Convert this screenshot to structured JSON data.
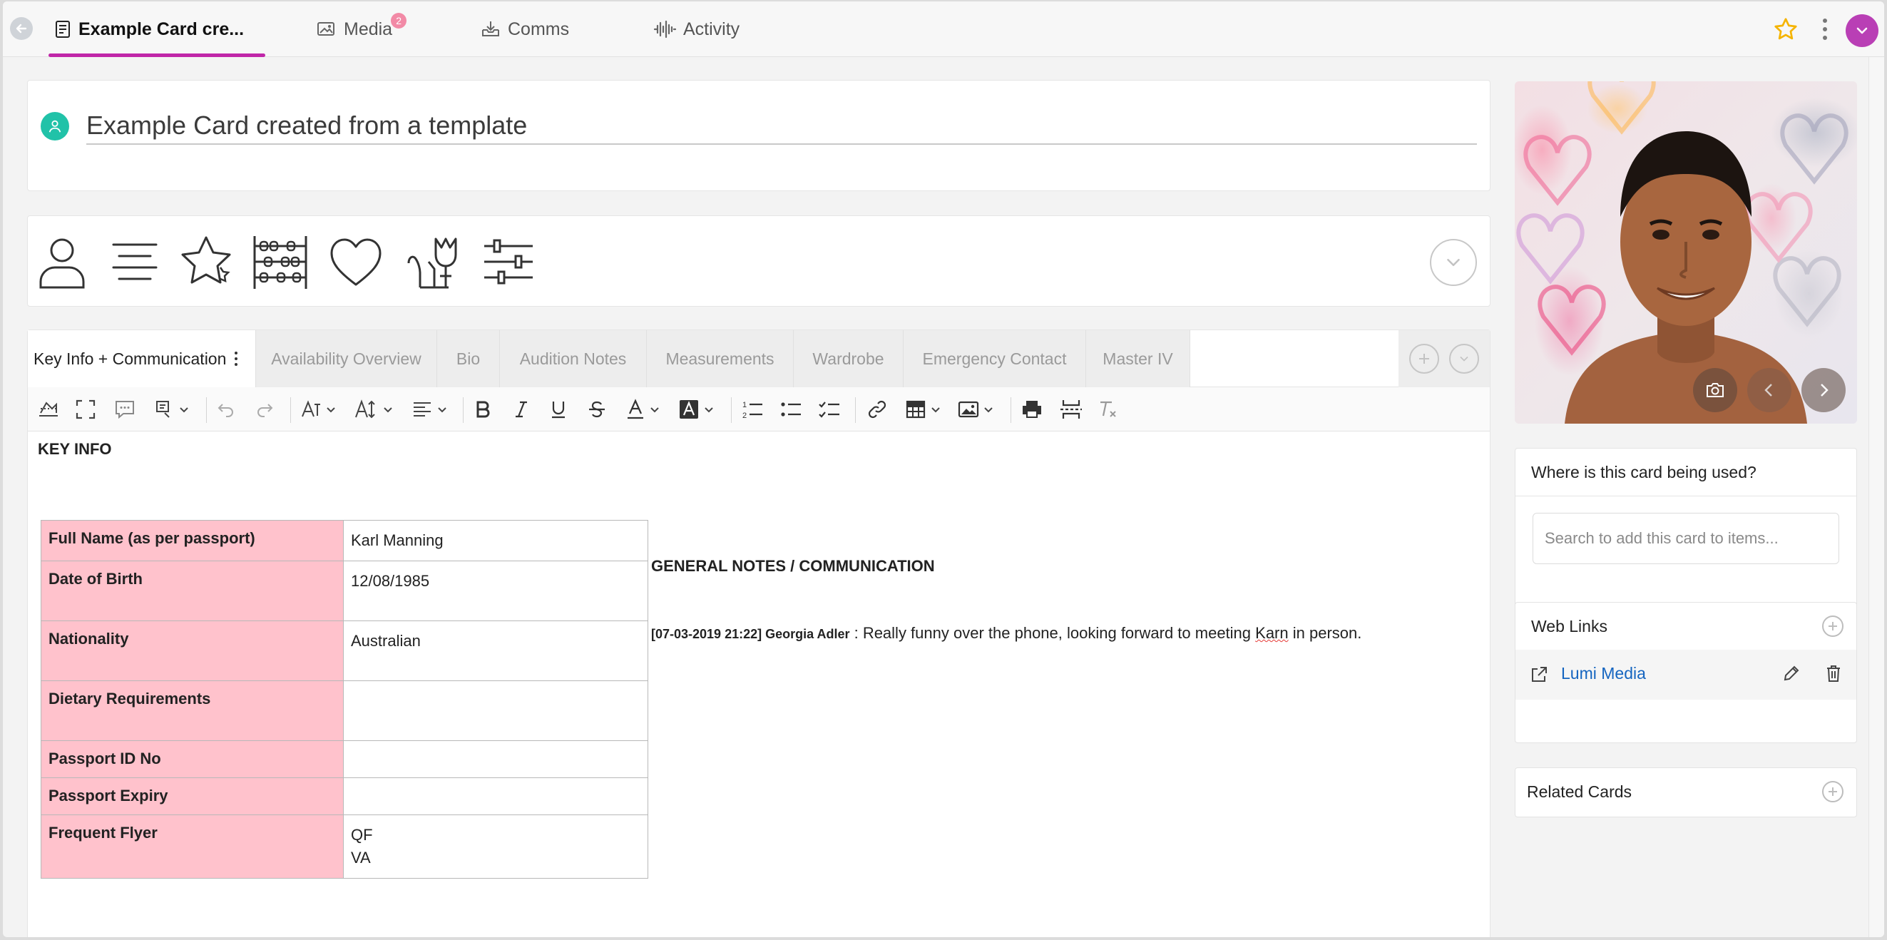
{
  "nav": {
    "tabs": [
      {
        "label": "Example Card cre...",
        "icon": "document-icon"
      },
      {
        "label": "Media",
        "icon": "image-icon",
        "badge": "2"
      },
      {
        "label": "Comms",
        "icon": "inbox-download-icon"
      },
      {
        "label": "Activity",
        "icon": "waveform-icon"
      }
    ]
  },
  "card": {
    "title": "Example Card created from a template"
  },
  "template_icons": [
    "person-icon",
    "text-lines-icon",
    "star-icon",
    "abacus-icon",
    "heart-icon",
    "cat-icon",
    "sliders-icon"
  ],
  "editor": {
    "tabs": [
      "Key Info + Communication",
      "Availability Overview",
      "Bio",
      "Audition Notes",
      "Measurements",
      "Wardrobe",
      "Emergency Contact",
      "Master IV"
    ],
    "toolbar": [
      "save-draft-icon",
      "fullscreen-icon",
      "comment-icon",
      "format-painter-icon",
      "undo-icon",
      "redo-icon",
      "font-family-icon",
      "font-size-icon",
      "align-icon",
      "bold-icon",
      "italic-icon",
      "underline-icon",
      "strikethrough-icon",
      "font-color-icon",
      "highlight-color-icon",
      "numbered-list-icon",
      "bullet-list-icon",
      "checklist-icon",
      "link-icon",
      "table-icon",
      "image-icon",
      "print-icon",
      "page-break-icon",
      "clear-format-icon"
    ]
  },
  "doc": {
    "key_info_heading": "KEY INFO",
    "rows": [
      {
        "label": "Full Name (as per passport)",
        "value": "Karl Manning"
      },
      {
        "label": "Date of Birth",
        "value": "12/08/1985"
      },
      {
        "label": "Nationality",
        "value": "Australian"
      },
      {
        "label": "Dietary Requirements",
        "value": ""
      },
      {
        "label": "Passport ID No",
        "value": ""
      },
      {
        "label": "Passport Expiry",
        "value": ""
      },
      {
        "label": "Frequent Flyer",
        "value": "QF",
        "value2": "VA"
      }
    ],
    "general_heading": "GENERAL NOTES / COMMUNICATION",
    "note": {
      "meta": "[07-03-2019 21:22] Georgia Adler",
      "sep": " : ",
      "text_before": "Really funny over the phone, looking forward to meeting ",
      "misspelled": "Karn",
      "text_after": " in person."
    }
  },
  "sidebar": {
    "usage": {
      "heading": "Where is this card being used?",
      "search_placeholder": "Search to add this card to items..."
    },
    "web_links": {
      "heading": "Web Links",
      "items": [
        {
          "label": "Lumi Media"
        }
      ]
    },
    "related_cards": {
      "heading": "Related Cards"
    }
  },
  "colors": {
    "accent": "#c026a8",
    "avatar": "#21c2a8",
    "label_cell": "#ffc2cc",
    "link": "#1565c0",
    "star": "#f5b400",
    "user": "#b93fb5"
  }
}
